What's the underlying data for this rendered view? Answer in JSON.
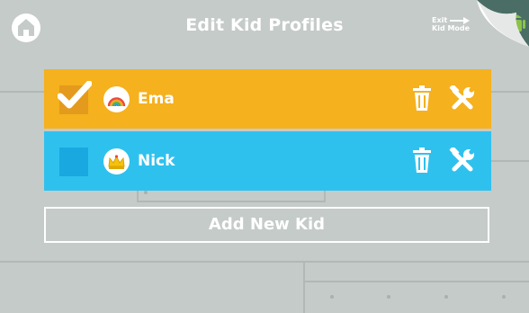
{
  "header": {
    "title": "Edit Kid Profiles",
    "home_icon": "home-icon",
    "exit": {
      "line1": "Exit",
      "line2": "Kid Mode",
      "arrow_icon": "arrow-right-icon",
      "android_icon": "android-icon"
    }
  },
  "profiles": [
    {
      "name": "Ema",
      "checked": true,
      "avatar_icon": "rainbow-icon",
      "row_color": "#f5b11e",
      "actions": [
        "trash-icon",
        "tools-icon"
      ]
    },
    {
      "name": "Nick",
      "checked": false,
      "avatar_icon": "crown-icon",
      "row_color": "#2fc1ee",
      "actions": [
        "trash-icon",
        "tools-icon"
      ]
    }
  ],
  "add_kid": {
    "label": "Add New Kid"
  },
  "colors": {
    "background": "#c5cbc8",
    "ema_row": "#f5b11e",
    "nick_row": "#2fc1ee",
    "text": "#ffffff",
    "android_green": "#8bc34a"
  }
}
